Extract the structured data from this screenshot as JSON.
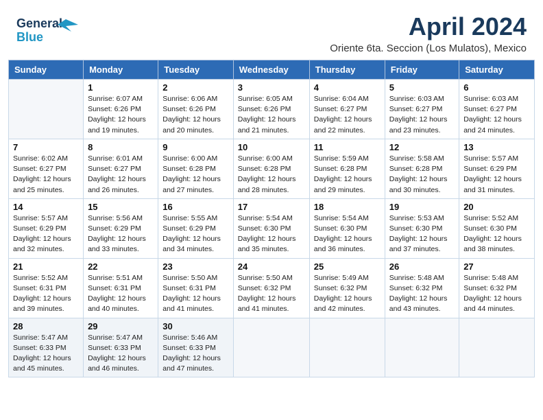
{
  "header": {
    "logo_line1": "General",
    "logo_line2": "Blue",
    "month": "April 2024",
    "location": "Oriente 6ta. Seccion (Los Mulatos), Mexico"
  },
  "weekdays": [
    "Sunday",
    "Monday",
    "Tuesday",
    "Wednesday",
    "Thursday",
    "Friday",
    "Saturday"
  ],
  "weeks": [
    [
      {
        "day": "",
        "info": ""
      },
      {
        "day": "1",
        "info": "Sunrise: 6:07 AM\nSunset: 6:26 PM\nDaylight: 12 hours\nand 19 minutes."
      },
      {
        "day": "2",
        "info": "Sunrise: 6:06 AM\nSunset: 6:26 PM\nDaylight: 12 hours\nand 20 minutes."
      },
      {
        "day": "3",
        "info": "Sunrise: 6:05 AM\nSunset: 6:26 PM\nDaylight: 12 hours\nand 21 minutes."
      },
      {
        "day": "4",
        "info": "Sunrise: 6:04 AM\nSunset: 6:27 PM\nDaylight: 12 hours\nand 22 minutes."
      },
      {
        "day": "5",
        "info": "Sunrise: 6:03 AM\nSunset: 6:27 PM\nDaylight: 12 hours\nand 23 minutes."
      },
      {
        "day": "6",
        "info": "Sunrise: 6:03 AM\nSunset: 6:27 PM\nDaylight: 12 hours\nand 24 minutes."
      }
    ],
    [
      {
        "day": "7",
        "info": "Sunrise: 6:02 AM\nSunset: 6:27 PM\nDaylight: 12 hours\nand 25 minutes."
      },
      {
        "day": "8",
        "info": "Sunrise: 6:01 AM\nSunset: 6:27 PM\nDaylight: 12 hours\nand 26 minutes."
      },
      {
        "day": "9",
        "info": "Sunrise: 6:00 AM\nSunset: 6:28 PM\nDaylight: 12 hours\nand 27 minutes."
      },
      {
        "day": "10",
        "info": "Sunrise: 6:00 AM\nSunset: 6:28 PM\nDaylight: 12 hours\nand 28 minutes."
      },
      {
        "day": "11",
        "info": "Sunrise: 5:59 AM\nSunset: 6:28 PM\nDaylight: 12 hours\nand 29 minutes."
      },
      {
        "day": "12",
        "info": "Sunrise: 5:58 AM\nSunset: 6:28 PM\nDaylight: 12 hours\nand 30 minutes."
      },
      {
        "day": "13",
        "info": "Sunrise: 5:57 AM\nSunset: 6:29 PM\nDaylight: 12 hours\nand 31 minutes."
      }
    ],
    [
      {
        "day": "14",
        "info": "Sunrise: 5:57 AM\nSunset: 6:29 PM\nDaylight: 12 hours\nand 32 minutes."
      },
      {
        "day": "15",
        "info": "Sunrise: 5:56 AM\nSunset: 6:29 PM\nDaylight: 12 hours\nand 33 minutes."
      },
      {
        "day": "16",
        "info": "Sunrise: 5:55 AM\nSunset: 6:29 PM\nDaylight: 12 hours\nand 34 minutes."
      },
      {
        "day": "17",
        "info": "Sunrise: 5:54 AM\nSunset: 6:30 PM\nDaylight: 12 hours\nand 35 minutes."
      },
      {
        "day": "18",
        "info": "Sunrise: 5:54 AM\nSunset: 6:30 PM\nDaylight: 12 hours\nand 36 minutes."
      },
      {
        "day": "19",
        "info": "Sunrise: 5:53 AM\nSunset: 6:30 PM\nDaylight: 12 hours\nand 37 minutes."
      },
      {
        "day": "20",
        "info": "Sunrise: 5:52 AM\nSunset: 6:30 PM\nDaylight: 12 hours\nand 38 minutes."
      }
    ],
    [
      {
        "day": "21",
        "info": "Sunrise: 5:52 AM\nSunset: 6:31 PM\nDaylight: 12 hours\nand 39 minutes."
      },
      {
        "day": "22",
        "info": "Sunrise: 5:51 AM\nSunset: 6:31 PM\nDaylight: 12 hours\nand 40 minutes."
      },
      {
        "day": "23",
        "info": "Sunrise: 5:50 AM\nSunset: 6:31 PM\nDaylight: 12 hours\nand 41 minutes."
      },
      {
        "day": "24",
        "info": "Sunrise: 5:50 AM\nSunset: 6:32 PM\nDaylight: 12 hours\nand 41 minutes."
      },
      {
        "day": "25",
        "info": "Sunrise: 5:49 AM\nSunset: 6:32 PM\nDaylight: 12 hours\nand 42 minutes."
      },
      {
        "day": "26",
        "info": "Sunrise: 5:48 AM\nSunset: 6:32 PM\nDaylight: 12 hours\nand 43 minutes."
      },
      {
        "day": "27",
        "info": "Sunrise: 5:48 AM\nSunset: 6:32 PM\nDaylight: 12 hours\nand 44 minutes."
      }
    ],
    [
      {
        "day": "28",
        "info": "Sunrise: 5:47 AM\nSunset: 6:33 PM\nDaylight: 12 hours\nand 45 minutes."
      },
      {
        "day": "29",
        "info": "Sunrise: 5:47 AM\nSunset: 6:33 PM\nDaylight: 12 hours\nand 46 minutes."
      },
      {
        "day": "30",
        "info": "Sunrise: 5:46 AM\nSunset: 6:33 PM\nDaylight: 12 hours\nand 47 minutes."
      },
      {
        "day": "",
        "info": ""
      },
      {
        "day": "",
        "info": ""
      },
      {
        "day": "",
        "info": ""
      },
      {
        "day": "",
        "info": ""
      }
    ]
  ]
}
